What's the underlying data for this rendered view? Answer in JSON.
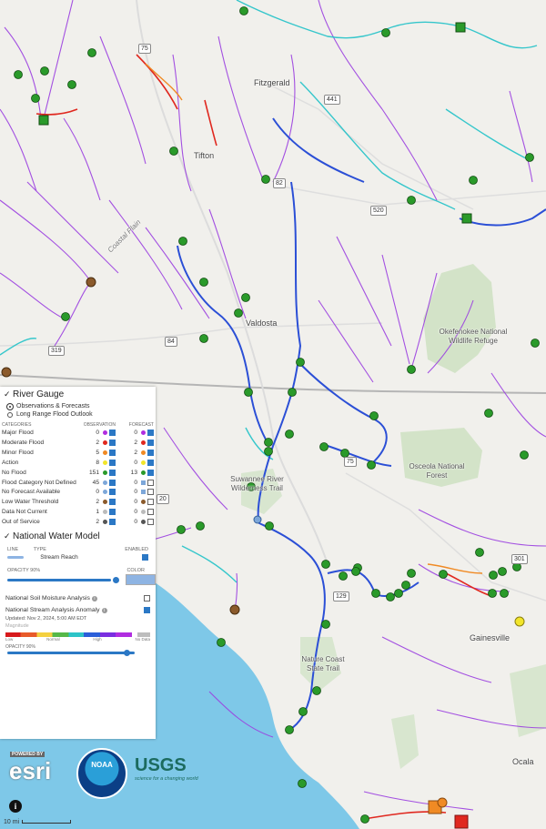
{
  "map": {
    "cities": [
      {
        "name": "Fitzgerald"
      },
      {
        "name": "Tifton"
      },
      {
        "name": "Valdosta"
      },
      {
        "name": "Gainesville"
      },
      {
        "name": "Ocala"
      }
    ],
    "regions": {
      "coastal_plain": "Coastal Plain",
      "okefenokee": "Okefenokee National Wildlife Refuge",
      "osceola": "Osceola National Forest",
      "suwannee_trail": "Suwannee River Wilderness Trail",
      "nature_coast": "Nature Coast State Trail"
    },
    "shields": [
      "75",
      "441",
      "82",
      "520",
      "319",
      "84",
      "75",
      "129",
      "301",
      "20"
    ],
    "scale_label": "10 mi"
  },
  "panel": {
    "river_gauge": {
      "title": "River Gauge",
      "options": [
        "Observations & Forecasts",
        "Long Range Flood Outlook"
      ],
      "headers": {
        "categories": "CATEGORIES",
        "observation": "OBSERVATION",
        "forecast": "FORECAST"
      },
      "rows": [
        {
          "label": "Major Flood",
          "obs": "0",
          "fc": "0",
          "color": "#b02de0"
        },
        {
          "label": "Moderate Flood",
          "obs": "2",
          "fc": "2",
          "color": "#e0281f"
        },
        {
          "label": "Minor Flood",
          "obs": "5",
          "fc": "2",
          "color": "#f08a24"
        },
        {
          "label": "Action",
          "obs": "8",
          "fc": "0",
          "color": "#f2e52a"
        },
        {
          "label": "No Flood",
          "obs": "151",
          "fc": "13",
          "color": "#2a9a2a"
        },
        {
          "label": "Flood Category Not Defined",
          "obs": "45",
          "fc": "0",
          "color": "#7da7d9"
        },
        {
          "label": "No Forecast Available",
          "obs": "0",
          "fc": "0",
          "color": "#7da7d9"
        },
        {
          "label": "Low Water Threshold",
          "obs": "2",
          "fc": "0",
          "color": "#8b5a2b"
        },
        {
          "label": "Data Not Current",
          "obs": "1",
          "fc": "0",
          "color": "#bbbbbb"
        },
        {
          "label": "Out of Service",
          "obs": "2",
          "fc": "0",
          "color": "#555555"
        }
      ]
    },
    "nwm": {
      "title": "National Water Model",
      "headers": {
        "line": "LINE",
        "type": "TYPE",
        "enabled": "ENABLED"
      },
      "layer": "Stream Reach",
      "opacity_label": "OPACITY 90%",
      "opacity": 0.9,
      "color_label": "COLOR"
    },
    "soil": {
      "label": "National Soil Moisture Analysis"
    },
    "anomaly": {
      "label": "National Stream Analysis Anomaly",
      "updated": "Updated: Nov 2, 2024, 5:00 AM EDT",
      "legend_title": "Magnitude",
      "low": "Low",
      "normal": "Normal",
      "high": "High",
      "nodata": "No Data",
      "opacity_label": "OPACITY 90%"
    }
  },
  "logos": {
    "esri_top": "POWERED BY",
    "esri": "esri",
    "noaa": "NOAA",
    "usgs": "USGS",
    "usgs_tag": "science for a changing world"
  }
}
